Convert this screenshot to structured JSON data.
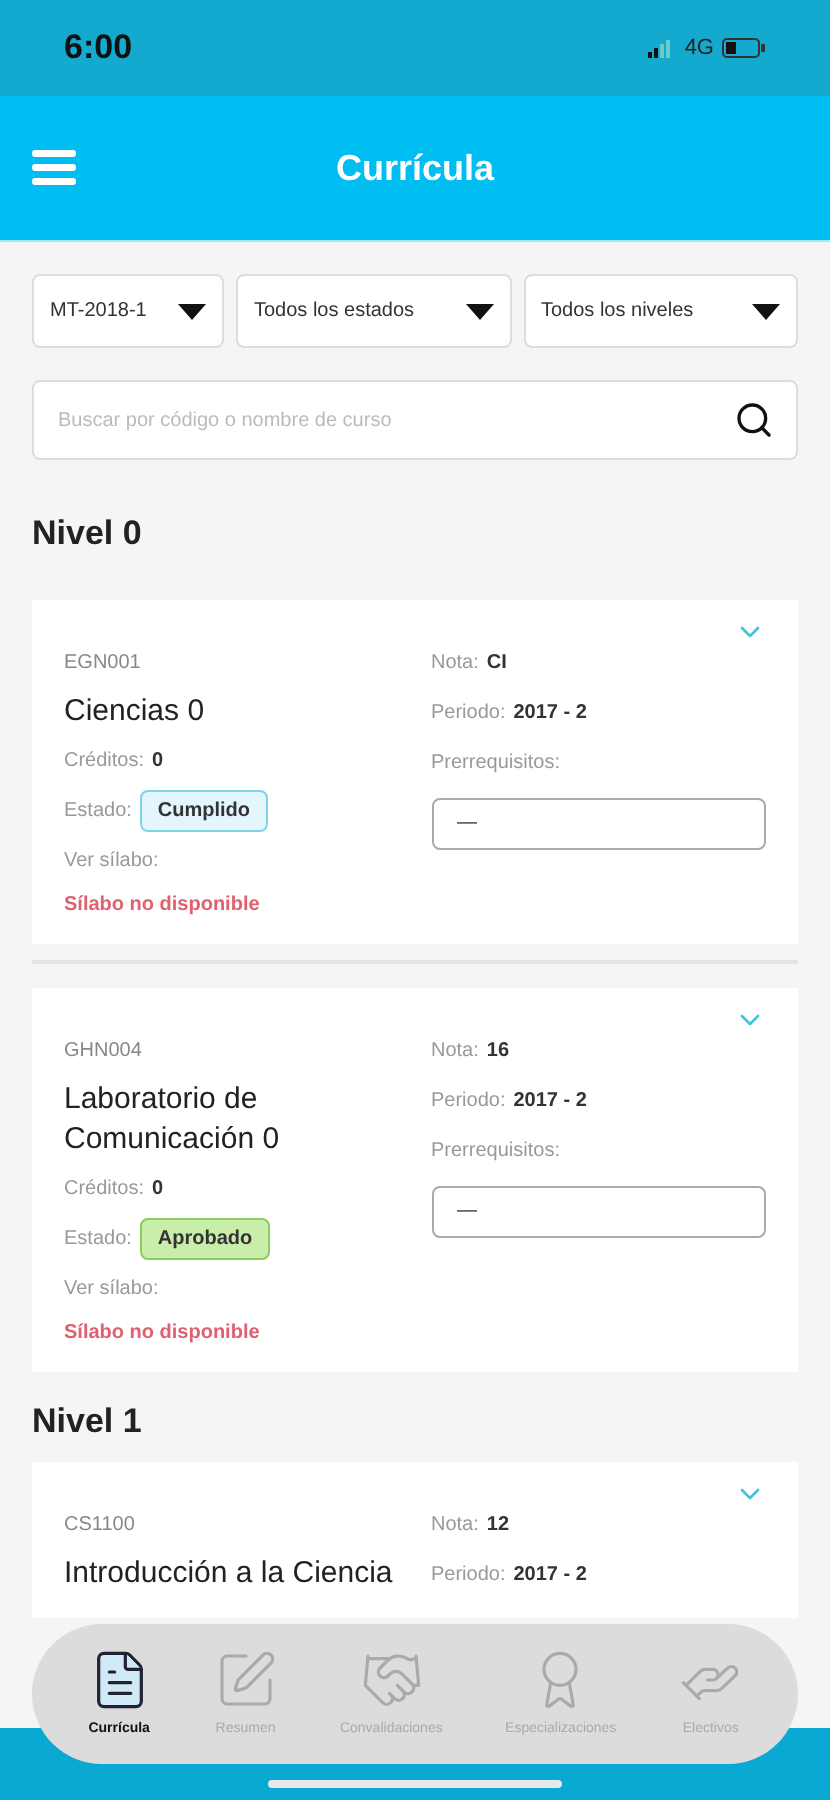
{
  "status_bar": {
    "time": "6:00",
    "network": "4G"
  },
  "header": {
    "title": "Currícula"
  },
  "filters": [
    {
      "value": "MT-2018-1"
    },
    {
      "value": "Todos los estados"
    },
    {
      "value": "Todos los niveles"
    }
  ],
  "search": {
    "placeholder": "Buscar por código o nombre de curso"
  },
  "levels": [
    {
      "title": "Nivel 0",
      "courses": [
        {
          "code": "EGN001",
          "name": "Ciencias 0",
          "expanded": false,
          "credits_label": "Créditos:",
          "credits": "0",
          "status_label": "Estado:",
          "status": {
            "text": "Cumplido",
            "kind": "cumplido"
          },
          "syllabus_label": "Ver sílabo:",
          "syllabus": "Sílabo no disponible",
          "grade_label": "Nota:",
          "grade": "CI",
          "period_label": "Periodo:",
          "period": "2017 - 2",
          "prereq_label": "Prerrequisitos:",
          "prereq": "—"
        },
        {
          "code": "GHN004",
          "name": "Laboratorio de Comunicación 0",
          "expanded": false,
          "credits_label": "Créditos:",
          "credits": "0",
          "status_label": "Estado:",
          "status": {
            "text": "Aprobado",
            "kind": "aprobado"
          },
          "syllabus_label": "Ver sílabo:",
          "syllabus": "Sílabo no disponible",
          "grade_label": "Nota:",
          "grade": "16",
          "period_label": "Periodo:",
          "period": "2017 - 2",
          "prereq_label": "Prerrequisitos:",
          "prereq": "—"
        }
      ]
    },
    {
      "title": "Nivel 1",
      "courses": [
        {
          "code": "CS1100",
          "name": "Introducción a la Ciencia",
          "expanded": false,
          "grade_label": "Nota:",
          "grade": "12",
          "period_label": "Periodo:",
          "period": "2017 - 2"
        }
      ]
    }
  ],
  "bottom_nav": [
    {
      "label": "Currícula",
      "kind": "document",
      "selected": true
    },
    {
      "label": "Resumen",
      "kind": "sign",
      "selected": false
    },
    {
      "label": "Convalidaciones",
      "kind": "handshake",
      "selected": false
    },
    {
      "label": "Especializaciones",
      "kind": "award",
      "selected": false
    },
    {
      "label": "Electivos",
      "kind": "hand",
      "selected": false
    }
  ]
}
